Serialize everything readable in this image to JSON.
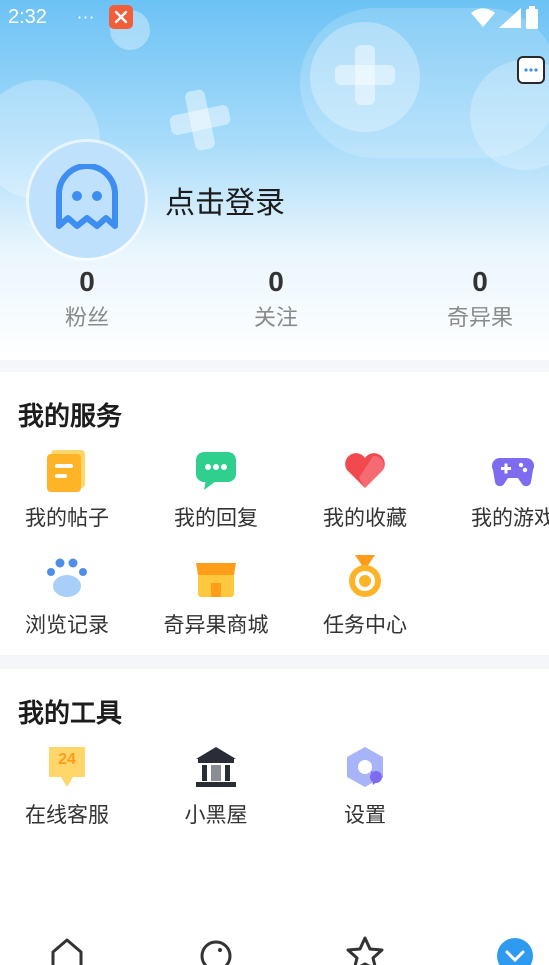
{
  "status": {
    "time": "2:32",
    "dots": "···"
  },
  "profile": {
    "login_label": "点击登录"
  },
  "stats": [
    {
      "value": "0",
      "label": "粉丝"
    },
    {
      "value": "0",
      "label": "关注"
    },
    {
      "value": "0",
      "label": "奇异果"
    }
  ],
  "services": {
    "title": "我的服务",
    "items": [
      {
        "label": "我的帖子",
        "icon": "post-icon"
      },
      {
        "label": "我的回复",
        "icon": "reply-icon"
      },
      {
        "label": "我的收藏",
        "icon": "favorite-heart-icon"
      },
      {
        "label": "我的游戏",
        "icon": "gamepad-icon"
      },
      {
        "label": "浏览记录",
        "icon": "paw-history-icon"
      },
      {
        "label": "奇异果商城",
        "icon": "store-icon"
      },
      {
        "label": "任务中心",
        "icon": "medal-icon"
      }
    ]
  },
  "tools": {
    "title": "我的工具",
    "items": [
      {
        "label": "在线客服",
        "icon": "support-24-icon",
        "badge": "24"
      },
      {
        "label": "小黑屋",
        "icon": "building-icon"
      },
      {
        "label": "设置",
        "icon": "settings-icon"
      }
    ]
  },
  "colors": {
    "header_top": "#6cc2f5",
    "avatar_bg": "#bfe1fb",
    "avatar_stroke": "#3d8ef0"
  }
}
